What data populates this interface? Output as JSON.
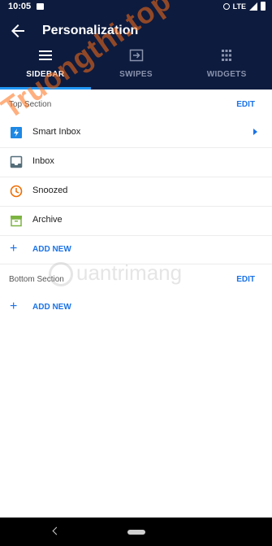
{
  "status_bar": {
    "time": "10:05",
    "network": "LTE"
  },
  "app_bar": {
    "title": "Personalization"
  },
  "tabs": [
    {
      "label": "SIDEBAR",
      "icon": "menu-icon",
      "active": true
    },
    {
      "label": "SWIPES",
      "icon": "swipe-icon",
      "active": false
    },
    {
      "label": "WIDGETS",
      "icon": "grid-icon",
      "active": false
    }
  ],
  "top_section": {
    "title": "Top Section",
    "edit_label": "EDIT",
    "items": [
      {
        "label": "Smart Inbox",
        "icon": "smart-inbox-icon",
        "color": "#1e88e5"
      },
      {
        "label": "Inbox",
        "icon": "inbox-icon",
        "color": "#546e7a"
      },
      {
        "label": "Snoozed",
        "icon": "clock-icon",
        "color": "#ef6c00"
      },
      {
        "label": "Archive",
        "icon": "archive-icon",
        "color": "#7cb342"
      }
    ],
    "add_label": "ADD NEW"
  },
  "bottom_section": {
    "title": "Bottom Section",
    "edit_label": "EDIT",
    "add_label": "ADD NEW"
  },
  "watermarks": {
    "primary": "Truongthi.top",
    "secondary": "uantrimang"
  },
  "colors": {
    "header_bg": "#0d1b3e",
    "accent": "#1a73e8",
    "indicator": "#2196f3"
  }
}
